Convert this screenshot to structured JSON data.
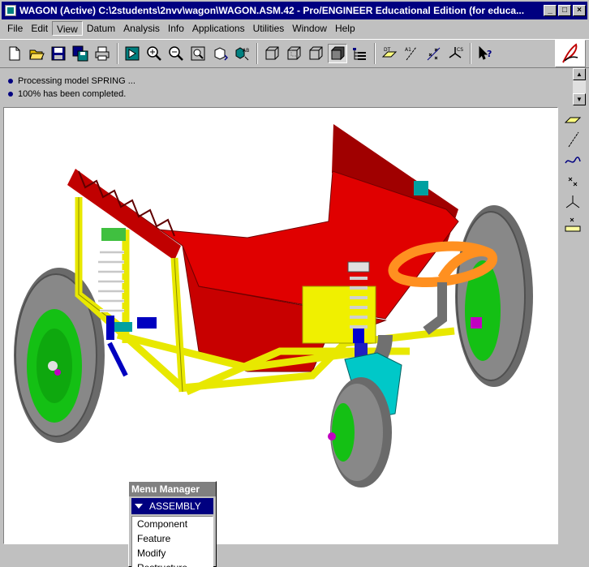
{
  "window": {
    "title": "WAGON (Active)  C:\\2students\\2nvv\\wagon\\WAGON.ASM.42 - Pro/ENGINEER Educational Edition (for educa...",
    "controls": [
      "_",
      "□",
      "×"
    ]
  },
  "menubar": {
    "items": [
      "File",
      "Edit",
      "View",
      "Datum",
      "Analysis",
      "Info",
      "Applications",
      "Utilities",
      "Window",
      "Help"
    ]
  },
  "toolbar": {
    "buttons": [
      "new-icon",
      "open-icon",
      "save-icon",
      "save-copy-icon",
      "print-icon",
      "repaint-icon",
      "zoom-in-icon",
      "zoom-out-icon",
      "refit-icon",
      "orient-icon",
      "saved-views-icon",
      "wireframe-icon",
      "hidden-line-icon",
      "no-hidden-icon",
      "shading-icon",
      "model-tree-icon",
      "datum-planes-icon",
      "datum-axes-icon",
      "datum-points-icon",
      "coord-sys-icon",
      "context-help-icon"
    ]
  },
  "messages": [
    "Processing model SPRING ...",
    "100% has been completed."
  ],
  "menu_manager": {
    "title": "Menu Manager",
    "header": "ASSEMBLY",
    "items": [
      "Component",
      "Feature",
      "Modify",
      "Restructure"
    ]
  },
  "colors": {
    "titlebar": "#000080",
    "frame": "#c0c0c0",
    "frame_yellow": "#e8e800",
    "bed_red": "#e00000",
    "wheel_green": "#10c000",
    "tire_gray": "#707070",
    "handle_orange": "#ff9020"
  }
}
